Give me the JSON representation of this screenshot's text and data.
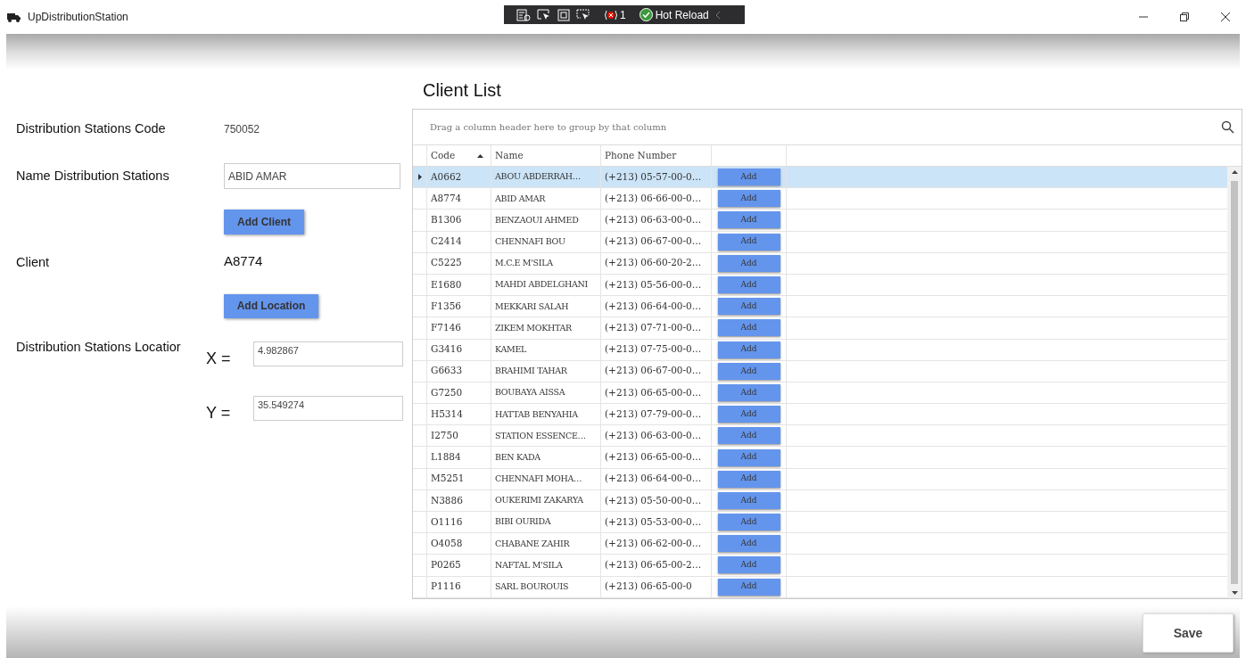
{
  "window": {
    "title": "UpDistributionStation"
  },
  "dev_toolbar": {
    "error_count": "1",
    "hot_reload": "Hot Reload"
  },
  "form": {
    "code_label": "Distribution Stations Code",
    "code_value": "750052",
    "name_label": "Name Distribution Stations",
    "name_value": "ABID AMAR",
    "add_client_button": "Add Client",
    "client_label": "Client",
    "client_value": "A8774",
    "add_location_button": "Add Location",
    "location_label": "Distribution Stations Locatior",
    "x_label": "X =",
    "x_value": "4.982867",
    "y_label": "Y =",
    "y_value": "35.549274"
  },
  "client_list": {
    "title": "Client List",
    "group_hint": "Drag a column header here to group by that column",
    "columns": [
      "Code",
      "Name",
      "Phone Number"
    ],
    "rows": [
      {
        "code": "A0662",
        "name": "ABOU ABDERRAH…",
        "phone": "(+213) 05-57-00-0…",
        "action": "Add",
        "selected": true
      },
      {
        "code": "A8774",
        "name": "ABID AMAR",
        "phone": "(+213) 06-66-00-0…",
        "action": "Add",
        "selected": false
      },
      {
        "code": "B1306",
        "name": "BENZAOUI AHMED",
        "phone": "(+213) 06-63-00-0…",
        "action": "Add",
        "selected": false
      },
      {
        "code": "C2414",
        "name": "CHENNAFI BOU",
        "phone": "(+213) 06-67-00-0…",
        "action": "Add",
        "selected": false
      },
      {
        "code": "C5225",
        "name": "M.C.E M'SILA",
        "phone": "(+213) 06-60-20-2…",
        "action": "Add",
        "selected": false
      },
      {
        "code": "E1680",
        "name": "MAHDI ABDELGHANI",
        "phone": "(+213) 05-56-00-0…",
        "action": "Add",
        "selected": false
      },
      {
        "code": "F1356",
        "name": "MEKKARI SALAH",
        "phone": "(+213) 06-64-00-0…",
        "action": "Add",
        "selected": false
      },
      {
        "code": "F7146",
        "name": "ZIKEM MOKHTAR",
        "phone": "(+213) 07-71-00-0…",
        "action": "Add",
        "selected": false
      },
      {
        "code": "G3416",
        "name": "KAMEL",
        "phone": "(+213) 07-75-00-0…",
        "action": "Add",
        "selected": false
      },
      {
        "code": "G6633",
        "name": "BRAHIMI TAHAR",
        "phone": "(+213) 06-67-00-0…",
        "action": "Add",
        "selected": false
      },
      {
        "code": "G7250",
        "name": "BOUBAYA AISSA",
        "phone": "(+213) 06-65-00-0…",
        "action": "Add",
        "selected": false
      },
      {
        "code": "H5314",
        "name": "HATTAB BENYAHIA",
        "phone": "(+213) 07-79-00-0…",
        "action": "Add",
        "selected": false
      },
      {
        "code": "I2750",
        "name": "STATION ESSENCE…",
        "phone": "(+213) 06-63-00-0…",
        "action": "Add",
        "selected": false
      },
      {
        "code": "L1884",
        "name": "BEN KADA",
        "phone": "(+213) 06-65-00-0…",
        "action": "Add",
        "selected": false
      },
      {
        "code": "M5251",
        "name": "CHENNAFI MOHA…",
        "phone": "(+213) 06-64-00-0…",
        "action": "Add",
        "selected": false
      },
      {
        "code": "N3886",
        "name": "OUKERIMI ZAKARYA",
        "phone": "(+213) 05-50-00-0…",
        "action": "Add",
        "selected": false
      },
      {
        "code": "O1116",
        "name": "BIBI OURIDA",
        "phone": "(+213) 05-53-00-0…",
        "action": "Add",
        "selected": false
      },
      {
        "code": "O4058",
        "name": "CHABANE ZAHIR",
        "phone": "(+213) 06-62-00-0…",
        "action": "Add",
        "selected": false
      },
      {
        "code": "P0265",
        "name": "NAFTAL M'SILA",
        "phone": "(+213) 06-65-00-2…",
        "action": "Add",
        "selected": false
      },
      {
        "code": "P1116",
        "name": "SARL BOUROUIS",
        "phone": "(+213) 06-65-00-0",
        "action": "Add",
        "selected": false
      }
    ]
  },
  "save_button": "Save"
}
